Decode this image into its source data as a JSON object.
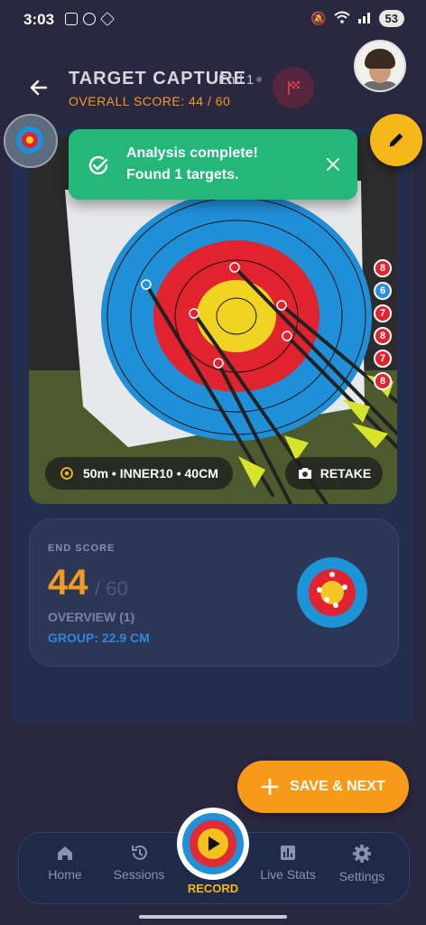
{
  "status": {
    "time": "3:03",
    "battery": "53"
  },
  "header": {
    "title": "TARGET CAPTURE",
    "end_label": "End 1",
    "overall_score": "OVERALL SCORE: 44 / 60"
  },
  "toast": {
    "line1": "Analysis complete!",
    "line2": "Found 1 targets.",
    "color": "#24b77a"
  },
  "photo": {
    "scores": [
      "8",
      "6",
      "7",
      "8",
      "7",
      "8"
    ],
    "score_colors": [
      "#e0232f",
      "#2b8fdc",
      "#e0232f",
      "#e0232f",
      "#e0232f",
      "#e0232f"
    ],
    "distance_info": "50m • INNER10 • 40CM",
    "retake_label": "RETAKE"
  },
  "card": {
    "end_score_label": "END SCORE",
    "score": "44",
    "max": "/ 60",
    "overview": "OVERVIEW (1)",
    "group": "GROUP: 22.9 CM"
  },
  "actions": {
    "save_next": "SAVE & NEXT"
  },
  "nav": {
    "home": "Home",
    "sessions": "Sessions",
    "record": "RECORD",
    "live_stats": "Live Stats",
    "settings": "Settings"
  },
  "colors": {
    "accent_orange": "#f39a22",
    "accent_yellow": "#f5b818",
    "background": "#2a2740"
  }
}
